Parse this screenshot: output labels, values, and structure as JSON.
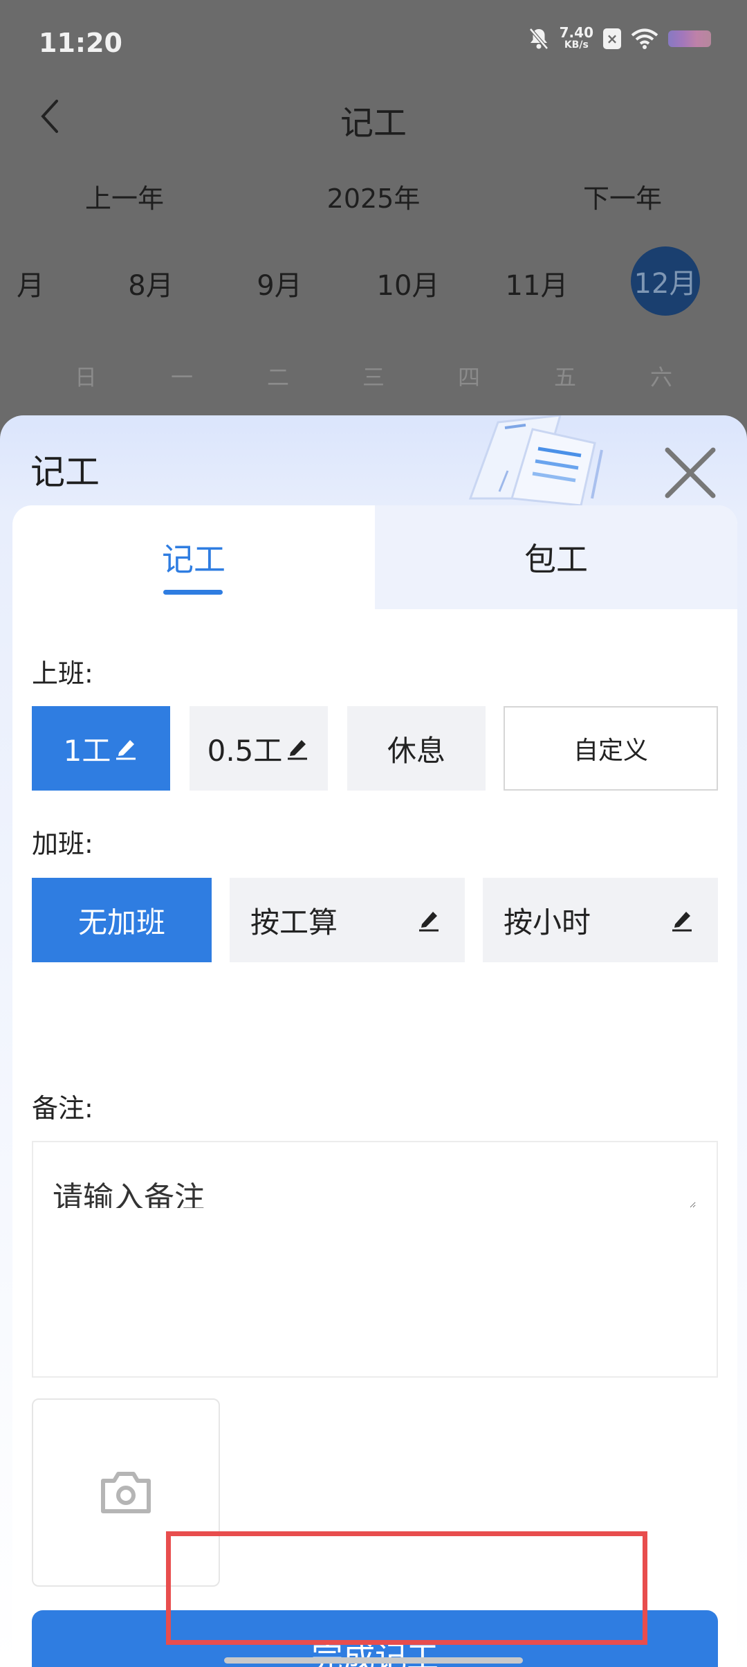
{
  "status_bar": {
    "time": "11:20",
    "net_speed_value": "7.40",
    "net_speed_unit": "KB/s",
    "icons": [
      "bell-off-icon",
      "x-badge-icon",
      "wifi-icon",
      "battery-icon"
    ]
  },
  "header": {
    "title": "记工"
  },
  "year_nav": {
    "prev": "上一年",
    "current": "2025年",
    "next": "下一年"
  },
  "months": [
    "月",
    "8月",
    "9月",
    "10月",
    "11月",
    "12月"
  ],
  "selected_month": "12月",
  "weekdays": [
    "日",
    "一",
    "二",
    "三",
    "四",
    "五",
    "六"
  ],
  "sheet": {
    "title": "记工",
    "tabs": [
      {
        "label": "记工",
        "active": true
      },
      {
        "label": "包工",
        "active": false
      }
    ],
    "work": {
      "label": "上班:",
      "options": [
        "1工",
        "0.5工",
        "休息",
        "自定义"
      ],
      "selected": "1工"
    },
    "overtime": {
      "label": "加班:",
      "options": [
        "无加班",
        "按工算",
        "按小时"
      ],
      "selected": "无加班"
    },
    "remark": {
      "label": "备注:",
      "placeholder": "请输入备注"
    },
    "photo": {
      "icon": "camera-icon"
    },
    "submit_label": "完成记工"
  },
  "colors": {
    "accent": "#2F7DE1",
    "highlight": "#E84D4D",
    "selected_month_bg": "#1A3F6F"
  }
}
